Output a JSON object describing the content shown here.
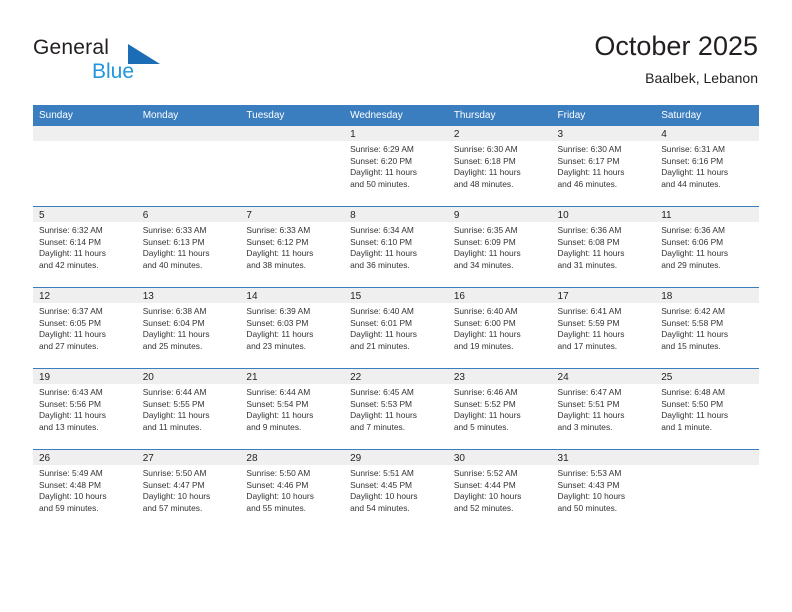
{
  "brand": {
    "name_part1": "General",
    "name_part2": "Blue",
    "triangle_color": "#1b6eb5",
    "blue_color": "#2196dd"
  },
  "header": {
    "title": "October 2025",
    "subtitle": "Baalbek, Lebanon"
  },
  "theme": {
    "header_bg": "#3a7ebf",
    "daynum_bg": "#efefef",
    "grid_line": "#3a7ebf",
    "text": "#231f20"
  },
  "weekdays": [
    "Sunday",
    "Monday",
    "Tuesday",
    "Wednesday",
    "Thursday",
    "Friday",
    "Saturday"
  ],
  "weeks": [
    [
      {
        "day": "",
        "sunrise": "",
        "sunset": "",
        "daylight1": "",
        "daylight2": ""
      },
      {
        "day": "",
        "sunrise": "",
        "sunset": "",
        "daylight1": "",
        "daylight2": ""
      },
      {
        "day": "",
        "sunrise": "",
        "sunset": "",
        "daylight1": "",
        "daylight2": ""
      },
      {
        "day": "1",
        "sunrise": "Sunrise: 6:29 AM",
        "sunset": "Sunset: 6:20 PM",
        "daylight1": "Daylight: 11 hours",
        "daylight2": "and 50 minutes."
      },
      {
        "day": "2",
        "sunrise": "Sunrise: 6:30 AM",
        "sunset": "Sunset: 6:18 PM",
        "daylight1": "Daylight: 11 hours",
        "daylight2": "and 48 minutes."
      },
      {
        "day": "3",
        "sunrise": "Sunrise: 6:30 AM",
        "sunset": "Sunset: 6:17 PM",
        "daylight1": "Daylight: 11 hours",
        "daylight2": "and 46 minutes."
      },
      {
        "day": "4",
        "sunrise": "Sunrise: 6:31 AM",
        "sunset": "Sunset: 6:16 PM",
        "daylight1": "Daylight: 11 hours",
        "daylight2": "and 44 minutes."
      }
    ],
    [
      {
        "day": "5",
        "sunrise": "Sunrise: 6:32 AM",
        "sunset": "Sunset: 6:14 PM",
        "daylight1": "Daylight: 11 hours",
        "daylight2": "and 42 minutes."
      },
      {
        "day": "6",
        "sunrise": "Sunrise: 6:33 AM",
        "sunset": "Sunset: 6:13 PM",
        "daylight1": "Daylight: 11 hours",
        "daylight2": "and 40 minutes."
      },
      {
        "day": "7",
        "sunrise": "Sunrise: 6:33 AM",
        "sunset": "Sunset: 6:12 PM",
        "daylight1": "Daylight: 11 hours",
        "daylight2": "and 38 minutes."
      },
      {
        "day": "8",
        "sunrise": "Sunrise: 6:34 AM",
        "sunset": "Sunset: 6:10 PM",
        "daylight1": "Daylight: 11 hours",
        "daylight2": "and 36 minutes."
      },
      {
        "day": "9",
        "sunrise": "Sunrise: 6:35 AM",
        "sunset": "Sunset: 6:09 PM",
        "daylight1": "Daylight: 11 hours",
        "daylight2": "and 34 minutes."
      },
      {
        "day": "10",
        "sunrise": "Sunrise: 6:36 AM",
        "sunset": "Sunset: 6:08 PM",
        "daylight1": "Daylight: 11 hours",
        "daylight2": "and 31 minutes."
      },
      {
        "day": "11",
        "sunrise": "Sunrise: 6:36 AM",
        "sunset": "Sunset: 6:06 PM",
        "daylight1": "Daylight: 11 hours",
        "daylight2": "and 29 minutes."
      }
    ],
    [
      {
        "day": "12",
        "sunrise": "Sunrise: 6:37 AM",
        "sunset": "Sunset: 6:05 PM",
        "daylight1": "Daylight: 11 hours",
        "daylight2": "and 27 minutes."
      },
      {
        "day": "13",
        "sunrise": "Sunrise: 6:38 AM",
        "sunset": "Sunset: 6:04 PM",
        "daylight1": "Daylight: 11 hours",
        "daylight2": "and 25 minutes."
      },
      {
        "day": "14",
        "sunrise": "Sunrise: 6:39 AM",
        "sunset": "Sunset: 6:03 PM",
        "daylight1": "Daylight: 11 hours",
        "daylight2": "and 23 minutes."
      },
      {
        "day": "15",
        "sunrise": "Sunrise: 6:40 AM",
        "sunset": "Sunset: 6:01 PM",
        "daylight1": "Daylight: 11 hours",
        "daylight2": "and 21 minutes."
      },
      {
        "day": "16",
        "sunrise": "Sunrise: 6:40 AM",
        "sunset": "Sunset: 6:00 PM",
        "daylight1": "Daylight: 11 hours",
        "daylight2": "and 19 minutes."
      },
      {
        "day": "17",
        "sunrise": "Sunrise: 6:41 AM",
        "sunset": "Sunset: 5:59 PM",
        "daylight1": "Daylight: 11 hours",
        "daylight2": "and 17 minutes."
      },
      {
        "day": "18",
        "sunrise": "Sunrise: 6:42 AM",
        "sunset": "Sunset: 5:58 PM",
        "daylight1": "Daylight: 11 hours",
        "daylight2": "and 15 minutes."
      }
    ],
    [
      {
        "day": "19",
        "sunrise": "Sunrise: 6:43 AM",
        "sunset": "Sunset: 5:56 PM",
        "daylight1": "Daylight: 11 hours",
        "daylight2": "and 13 minutes."
      },
      {
        "day": "20",
        "sunrise": "Sunrise: 6:44 AM",
        "sunset": "Sunset: 5:55 PM",
        "daylight1": "Daylight: 11 hours",
        "daylight2": "and 11 minutes."
      },
      {
        "day": "21",
        "sunrise": "Sunrise: 6:44 AM",
        "sunset": "Sunset: 5:54 PM",
        "daylight1": "Daylight: 11 hours",
        "daylight2": "and 9 minutes."
      },
      {
        "day": "22",
        "sunrise": "Sunrise: 6:45 AM",
        "sunset": "Sunset: 5:53 PM",
        "daylight1": "Daylight: 11 hours",
        "daylight2": "and 7 minutes."
      },
      {
        "day": "23",
        "sunrise": "Sunrise: 6:46 AM",
        "sunset": "Sunset: 5:52 PM",
        "daylight1": "Daylight: 11 hours",
        "daylight2": "and 5 minutes."
      },
      {
        "day": "24",
        "sunrise": "Sunrise: 6:47 AM",
        "sunset": "Sunset: 5:51 PM",
        "daylight1": "Daylight: 11 hours",
        "daylight2": "and 3 minutes."
      },
      {
        "day": "25",
        "sunrise": "Sunrise: 6:48 AM",
        "sunset": "Sunset: 5:50 PM",
        "daylight1": "Daylight: 11 hours",
        "daylight2": "and 1 minute."
      }
    ],
    [
      {
        "day": "26",
        "sunrise": "Sunrise: 5:49 AM",
        "sunset": "Sunset: 4:48 PM",
        "daylight1": "Daylight: 10 hours",
        "daylight2": "and 59 minutes."
      },
      {
        "day": "27",
        "sunrise": "Sunrise: 5:50 AM",
        "sunset": "Sunset: 4:47 PM",
        "daylight1": "Daylight: 10 hours",
        "daylight2": "and 57 minutes."
      },
      {
        "day": "28",
        "sunrise": "Sunrise: 5:50 AM",
        "sunset": "Sunset: 4:46 PM",
        "daylight1": "Daylight: 10 hours",
        "daylight2": "and 55 minutes."
      },
      {
        "day": "29",
        "sunrise": "Sunrise: 5:51 AM",
        "sunset": "Sunset: 4:45 PM",
        "daylight1": "Daylight: 10 hours",
        "daylight2": "and 54 minutes."
      },
      {
        "day": "30",
        "sunrise": "Sunrise: 5:52 AM",
        "sunset": "Sunset: 4:44 PM",
        "daylight1": "Daylight: 10 hours",
        "daylight2": "and 52 minutes."
      },
      {
        "day": "31",
        "sunrise": "Sunrise: 5:53 AM",
        "sunset": "Sunset: 4:43 PM",
        "daylight1": "Daylight: 10 hours",
        "daylight2": "and 50 minutes."
      },
      {
        "day": "",
        "sunrise": "",
        "sunset": "",
        "daylight1": "",
        "daylight2": ""
      }
    ]
  ]
}
